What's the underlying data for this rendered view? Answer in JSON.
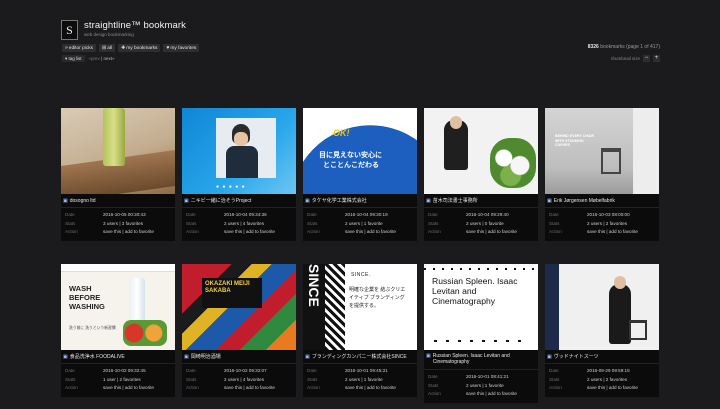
{
  "header": {
    "logo": "S",
    "title": "straightline™ bookmark",
    "subtitle": "web design bookmarking"
  },
  "nav": [
    {
      "icon": "»",
      "label": "editor picks"
    },
    {
      "icon": "⊞",
      "label": "all"
    },
    {
      "icon": "✚",
      "label": "my bookmarks"
    },
    {
      "icon": "♥",
      "label": "my favorites"
    }
  ],
  "subnav": {
    "tag_list": "tag list",
    "prev": "«prev",
    "next": "next»"
  },
  "info": {
    "count": "8326",
    "text": "bookmarks (page 1 of 417)",
    "thumbnail_size": "thumbnail size"
  },
  "meta_keys": {
    "date": "Date",
    "stats": "Stats",
    "action": "Action"
  },
  "cards": [
    {
      "name": "dosogno ltd",
      "date": "2016-10-05 00:30:43",
      "stats": "3 users | 3 favorites",
      "action": "save this | add to favorite"
    },
    {
      "name": "ニキビ一緒に治そうProject",
      "date": "2016-10-04 09:34:36",
      "stats": "2 users | 4 favorites",
      "action": "save this | add to favorite"
    },
    {
      "name": "タケヤ化学工業株式会社",
      "date": "2016-10-04 09:30:19",
      "stats": "2 users | 1 favorite",
      "action": "save this | add to favorite"
    },
    {
      "name": "苗木司法書士事務所",
      "date": "2016-10-04 09:29:40",
      "stats": "2 users | 0 favorite",
      "action": "save this | add to favorite"
    },
    {
      "name": "Erik Jørgensen Møbelfabrik",
      "date": "2016-10-03 08:00:00",
      "stats": "2 users | 2 favorites",
      "action": "save this | add to favorite"
    },
    {
      "name": "食品洗浄水 FOODALIVE",
      "date": "2016-10-02 09:32:45",
      "stats": "1 user | 2 favorites",
      "action": "save this | add to favorite"
    },
    {
      "name": "岡崎明治酒場",
      "date": "2016-10-02 09:32:07",
      "stats": "2 users | 4 favorites",
      "action": "save this | add to favorite"
    },
    {
      "name": "ブランディングカンパニー株式会社SINCE",
      "date": "2016-10-01 09:45:31",
      "stats": "2 users | 1 favorite",
      "action": "save this | add to favorite"
    },
    {
      "name": "Russian Spleen. Isaac Levitan and Cinematography",
      "date": "2016-10-01 08:41:21",
      "stats": "2 users | 1 favorite",
      "action": "save this | add to favorite"
    },
    {
      "name": "ヴッドナイトスーツ",
      "date": "2016-09-29 09:59:18",
      "stats": "2 users | 2 favorites",
      "action": "save this | add to favorite"
    }
  ],
  "thumbs": {
    "c2_dots": "● ● ● ● ●",
    "c3_ok": "OK!",
    "c3_line1": "目に見えない安心に",
    "c3_line2": "とことんこだわる",
    "c5_text": "BEHIND EVERY CHAIR WITH STANDING CURVES",
    "c6_text": "WASH BEFORE WASHING",
    "c6_sub": "洗う前に 洗うという新習慣",
    "c7_text": "OKAZAKI MEIJI SAKABA",
    "c8_big": "SINCE",
    "c8_t1": "SINCE.",
    "c8_t2": "明確な企業を 結ぶクリエイティブ ブランディング を提供する。",
    "c9_text": "Russian Spleen. Isaac Levitan and Cinematography"
  }
}
